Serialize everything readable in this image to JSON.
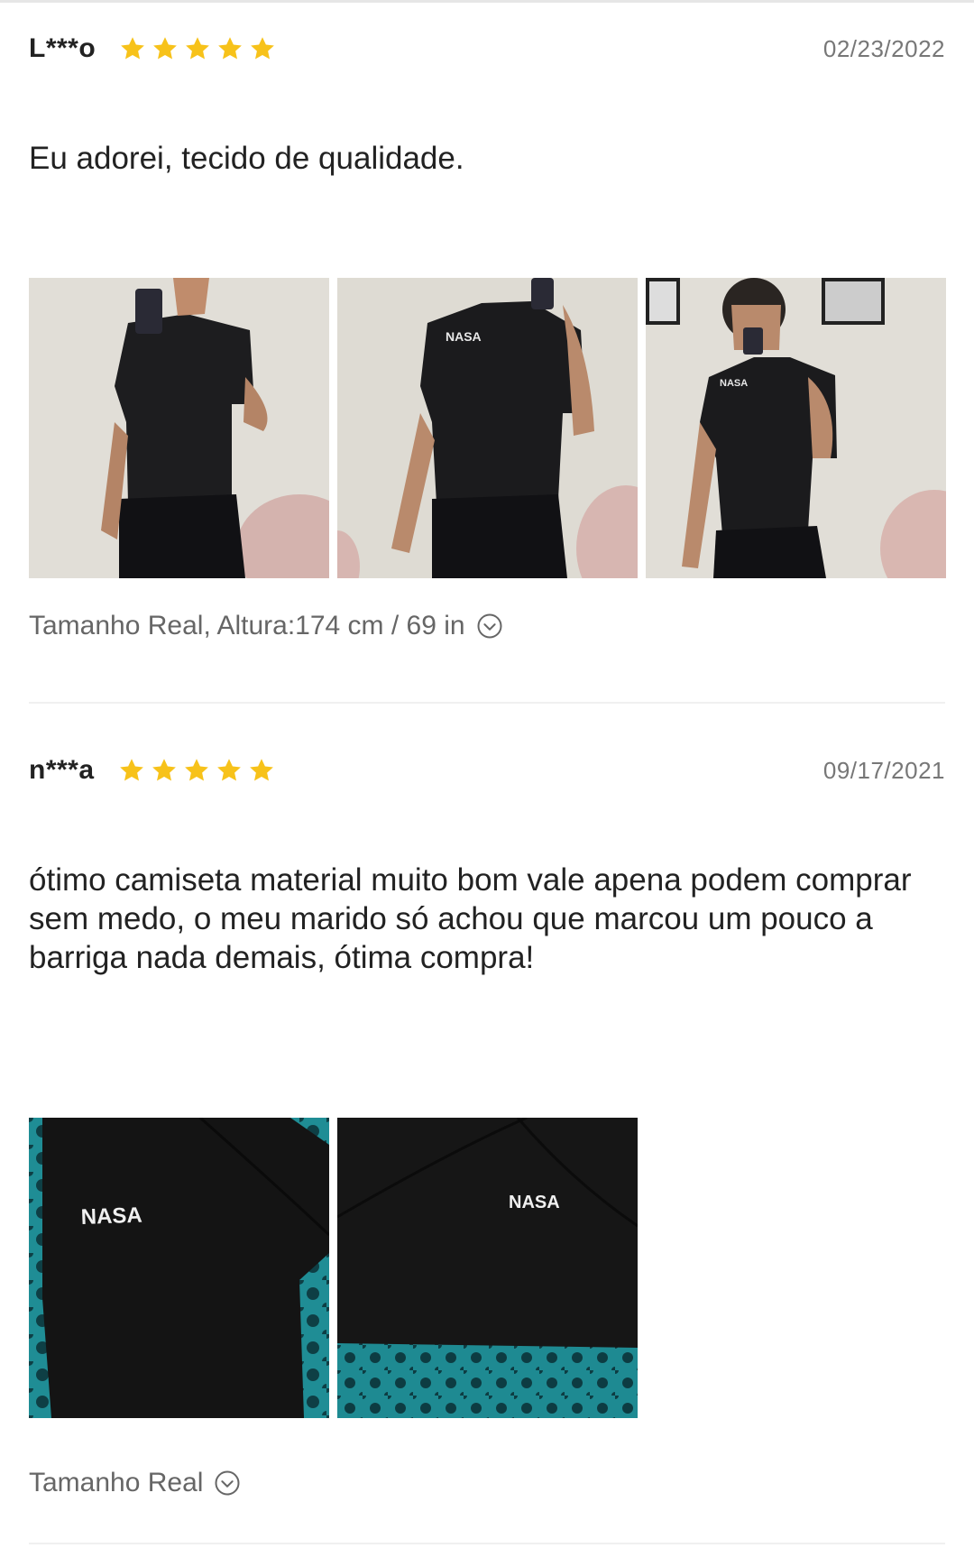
{
  "reviews": [
    {
      "author": "L***o",
      "rating": 5,
      "date": "02/23/2022",
      "text": "Eu adorei, tecido de qualidade.",
      "size_info": "Tamanho Real, Altura:174 cm / 69 in",
      "photo_count": 3
    },
    {
      "author": "n***a",
      "rating": 5,
      "date": "09/17/2021",
      "text": "ótimo camiseta material muito bom vale apena podem comprar sem medo, o meu marido só achou que marcou um pouco a barriga nada demais, ótima compra!",
      "size_info": "Tamanho Real",
      "photo_count": 2,
      "photo_logo_text": "NASA"
    }
  ],
  "icons": {
    "star": "star-icon",
    "expand": "chevron-down-circle-icon"
  },
  "colors": {
    "star": "#f7c21a",
    "author": "#222222",
    "meta": "#777777",
    "divider": "#f0f0f0"
  }
}
